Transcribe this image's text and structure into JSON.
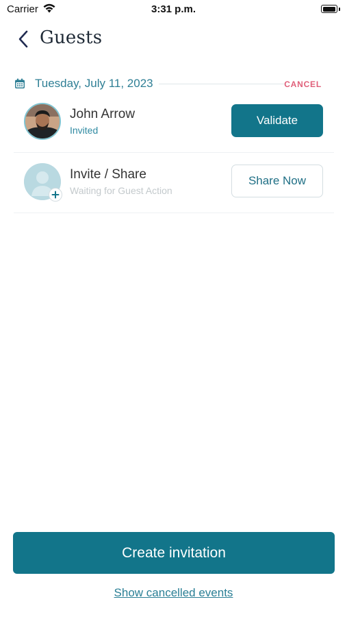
{
  "status_bar": {
    "carrier": "Carrier",
    "time": "3:31 p.m.",
    "icons": [
      "wifi-icon",
      "battery-icon"
    ]
  },
  "nav": {
    "title": "Guests",
    "back_icon": "chevron-left-icon"
  },
  "event": {
    "date": "Tuesday, July 11, 2023",
    "cancel_label": "CANCEL",
    "calendar_icon": "calendar-icon"
  },
  "guests": [
    {
      "name": "John Arrow",
      "status": "Invited",
      "action_label": "Validate",
      "avatar": "user-photo"
    },
    {
      "name": "Invite / Share",
      "status": "Waiting for Guest Action",
      "action_label": "Share Now",
      "avatar": "user-placeholder-icon"
    }
  ],
  "footer": {
    "create_label": "Create invitation",
    "show_cancelled_label": "Show cancelled events"
  },
  "colors": {
    "primary": "#12758a",
    "accent_text": "#2f7f95",
    "cancel": "#e0607a",
    "muted": "#c3c9cc"
  }
}
